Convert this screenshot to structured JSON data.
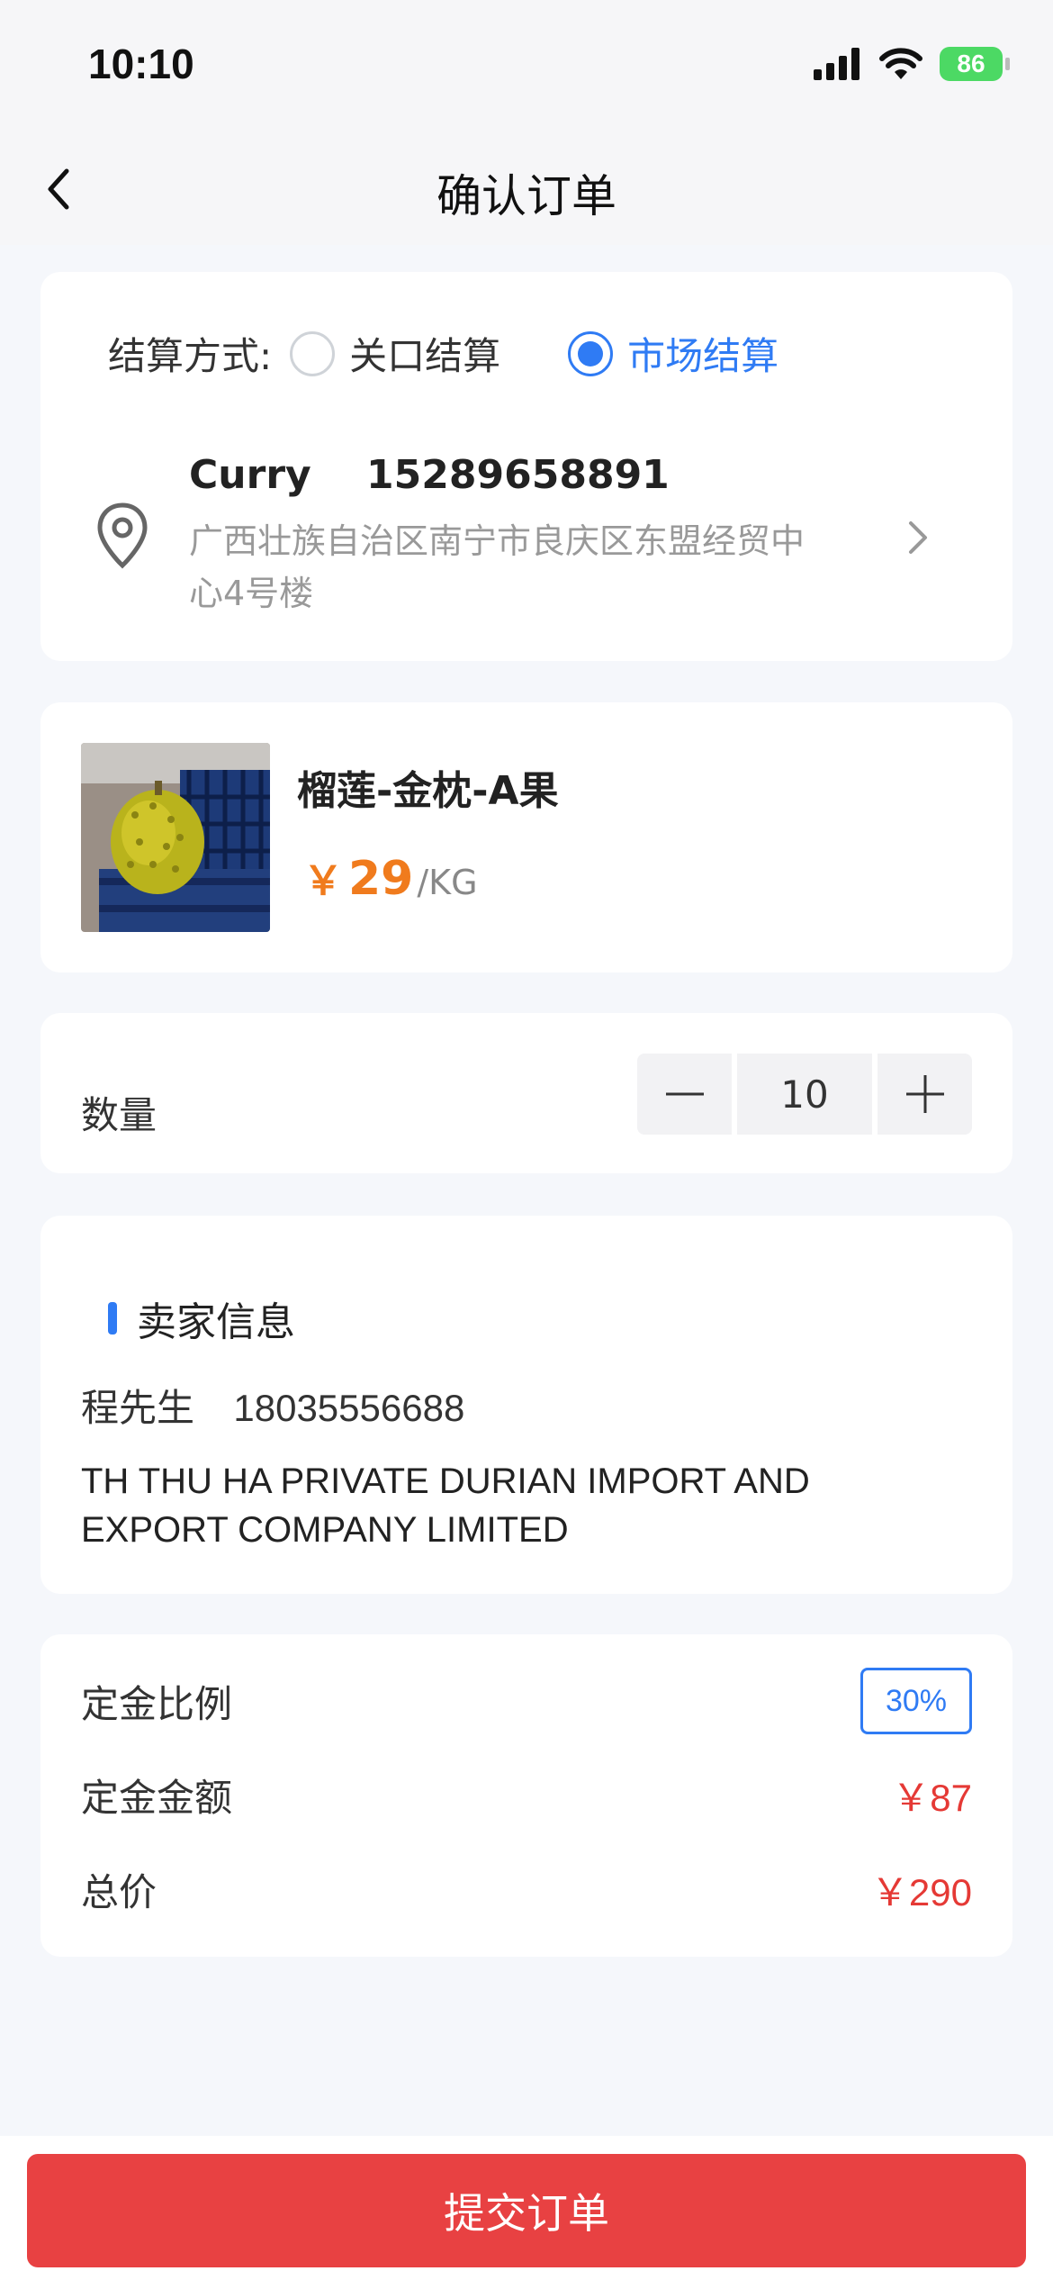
{
  "status_bar": {
    "time": "10:10",
    "battery": "86"
  },
  "nav": {
    "title": "确认订单"
  },
  "settlement": {
    "label": "结算方式:",
    "options": [
      {
        "label": "关口结算",
        "selected": false
      },
      {
        "label": "市场结算",
        "selected": true
      }
    ]
  },
  "address": {
    "name": "Curry",
    "phone": "15289658891",
    "detail": "广西壮族自治区南宁市良庆区东盟经贸中心4号楼"
  },
  "product": {
    "name": "榴莲-金枕-A果",
    "currency": "￥",
    "price": "29",
    "unit": "/KG"
  },
  "quantity": {
    "label": "数量",
    "value": "10"
  },
  "seller": {
    "title": "卖家信息",
    "name": "程先生",
    "phone": "18035556688",
    "company": "TH THU HA PRIVATE DURIAN IMPORT AND EXPORT COMPANY LIMITED"
  },
  "summary": {
    "deposit_ratio_label": "定金比例",
    "deposit_ratio": "30%",
    "deposit_amount_label": "定金金额",
    "deposit_amount": "￥87",
    "total_label": "总价",
    "total": "￥290"
  },
  "submit": {
    "label": "提交订单"
  },
  "colors": {
    "accent": "#2f7bf4",
    "price": "#f07b1d",
    "danger": "#e84142"
  }
}
